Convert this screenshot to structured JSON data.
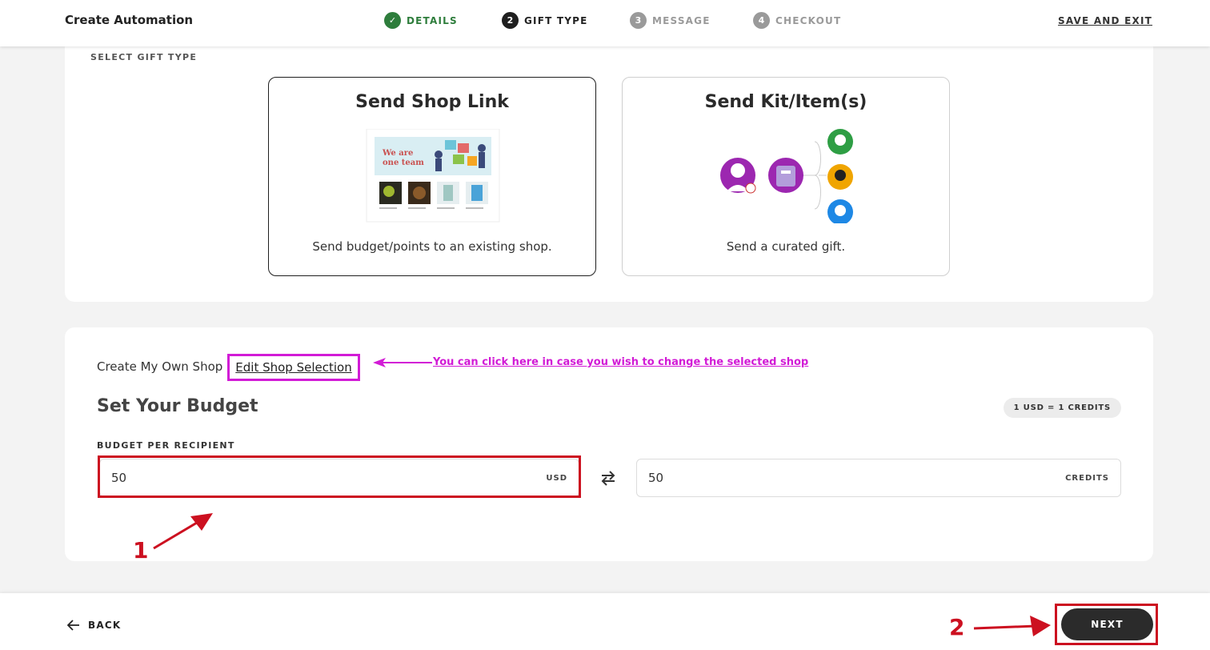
{
  "header": {
    "title": "Create Automation",
    "steps": [
      {
        "num": "✓",
        "label": "DETAILS",
        "state": "done"
      },
      {
        "num": "2",
        "label": "GIFT TYPE",
        "state": "active"
      },
      {
        "num": "3",
        "label": "MESSAGE",
        "state": "todo"
      },
      {
        "num": "4",
        "label": "CHECKOUT",
        "state": "todo"
      }
    ],
    "save_exit": "SAVE AND EXIT"
  },
  "gift_type": {
    "section_label": "SELECT GIFT TYPE",
    "options": [
      {
        "title": "Send Shop Link",
        "description": "Send budget/points to an existing shop.",
        "selected": true,
        "icon": "shop-preview-image"
      },
      {
        "title": "Send Kit/Item(s)",
        "description": "Send a curated gift.",
        "selected": false,
        "icon": "kit-recipients-illustration"
      }
    ],
    "preview": {
      "banner_line1": "We are",
      "banner_line2": "one team"
    }
  },
  "budget": {
    "shop_label": "Create My Own Shop",
    "edit_link": "Edit Shop Selection",
    "annotation_hint": "You can click here in case you wish to change the selected shop",
    "title": "Set Your Budget",
    "rate_badge": "1 USD = 1 CREDITS",
    "field_label": "BUDGET PER RECIPIENT",
    "usd_value": "50",
    "usd_unit": "USD",
    "credits_value": "50",
    "credits_unit": "CREDITS",
    "annotation_step1": "1"
  },
  "footer": {
    "back_label": "BACK",
    "next_label": "NEXT",
    "annotation_step2": "2"
  },
  "colors": {
    "done_green": "#2e7d3c",
    "annotation_magenta": "#d21bd6",
    "annotation_red": "#cc1020"
  }
}
